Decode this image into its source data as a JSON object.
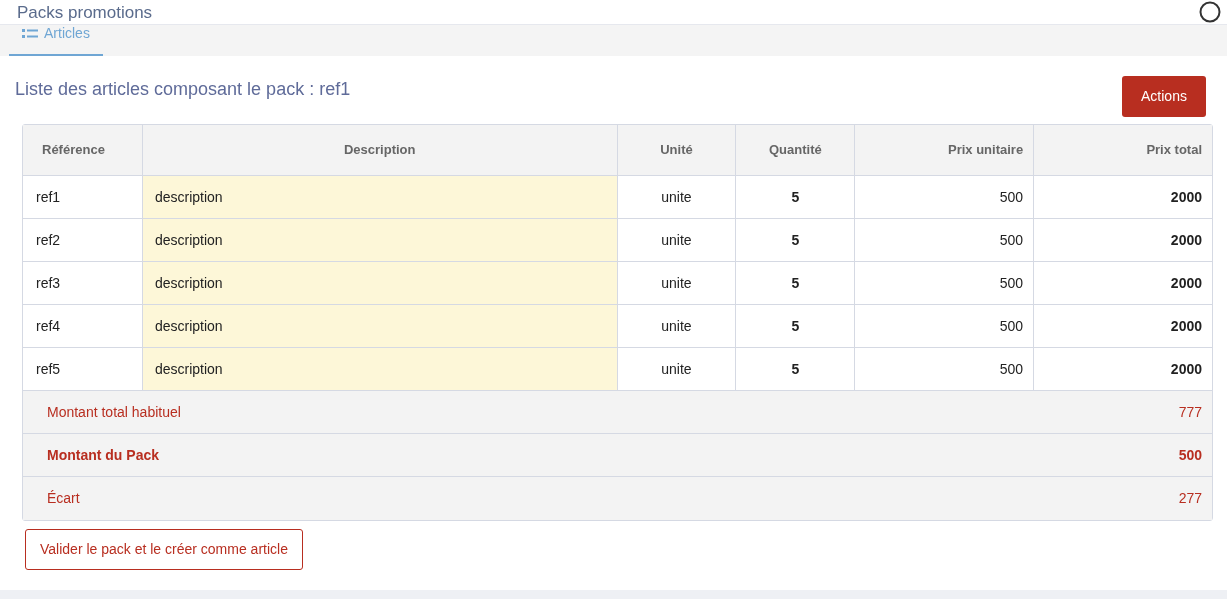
{
  "page": {
    "title": "Packs promotions"
  },
  "tabs": [
    {
      "label": "Articles",
      "selected": true
    }
  ],
  "heading": "Liste des articles composant le pack : ref1",
  "actions_button": "Actions",
  "table": {
    "columns": [
      "Référence",
      "Description",
      "Unité",
      "Quantité",
      "Prix unitaire",
      "Prix total"
    ],
    "rows": [
      {
        "reference": "ref1",
        "description": "description",
        "unit": "unite",
        "quantity": "5",
        "unit_price": "500",
        "total": "2000"
      },
      {
        "reference": "ref2",
        "description": "description",
        "unit": "unite",
        "quantity": "5",
        "unit_price": "500",
        "total": "2000"
      },
      {
        "reference": "ref3",
        "description": "description",
        "unit": "unite",
        "quantity": "5",
        "unit_price": "500",
        "total": "2000"
      },
      {
        "reference": "ref4",
        "description": "description",
        "unit": "unite",
        "quantity": "5",
        "unit_price": "500",
        "total": "2000"
      },
      {
        "reference": "ref5",
        "description": "description",
        "unit": "unite",
        "quantity": "5",
        "unit_price": "500",
        "total": "2000"
      }
    ],
    "summary": [
      {
        "label": "Montant total habituel",
        "value": "777",
        "kind": "normal"
      },
      {
        "label": "Montant du Pack",
        "value": "500",
        "kind": "bold"
      },
      {
        "label": "Écart",
        "value": "277",
        "kind": "normal"
      }
    ]
  },
  "validate_button": "Valider le pack et le créer comme article"
}
